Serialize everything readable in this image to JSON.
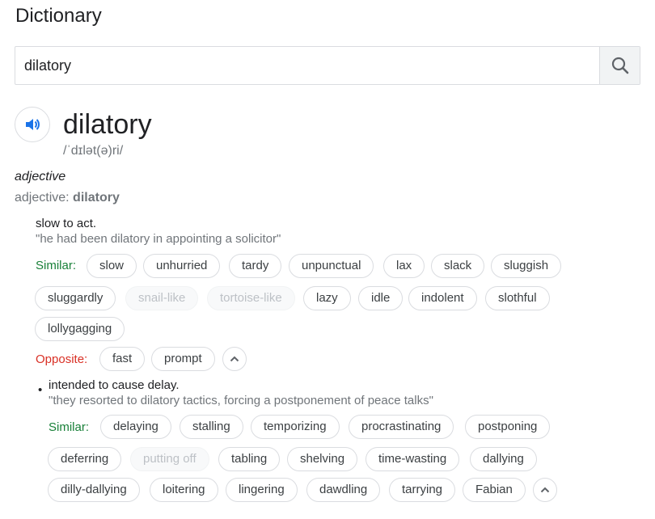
{
  "header": {
    "title": "Dictionary"
  },
  "search": {
    "value": "dilatory"
  },
  "entry": {
    "word": "dilatory",
    "phonetic": "/ˈdɪlət(ə)ri/",
    "part_of_speech": "adjective",
    "pos_prefix": "adjective: ",
    "pos_word": "dilatory"
  },
  "senses": [
    {
      "definition": "slow to act.",
      "example": "\"he had been dilatory in appointing a solicitor\"",
      "similar_label": "Similar:",
      "similar": [
        "slow",
        "unhurried",
        "tardy",
        "unpunctual",
        "lax",
        "slack",
        "sluggish",
        "sluggardly",
        "snail-like",
        "tortoise-like",
        "lazy",
        "idle",
        "indolent",
        "slothful",
        "lollygagging"
      ],
      "opposite_label": "Opposite:",
      "opposite": [
        "fast",
        "prompt"
      ]
    },
    {
      "bullet": "•",
      "definition": "intended to cause delay.",
      "example": "\"they resorted to dilatory tactics, forcing a postponement of peace talks\"",
      "similar_label": "Similar:",
      "similar": [
        "delaying",
        "stalling",
        "temporizing",
        "procrastinating",
        "postponing",
        "deferring",
        "putting off",
        "tabling",
        "shelving",
        "time-wasting",
        "dallying",
        "dilly-dallying",
        "loitering",
        "lingering",
        "dawdling",
        "tarrying",
        "Fabian"
      ]
    }
  ]
}
